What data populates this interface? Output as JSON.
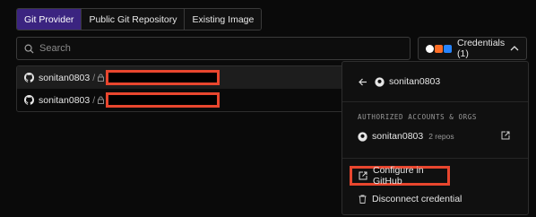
{
  "tabs": [
    {
      "label": "Git Provider",
      "active": true
    },
    {
      "label": "Public Git Repository",
      "active": false
    },
    {
      "label": "Existing Image",
      "active": false
    }
  ],
  "search": {
    "placeholder": "Search",
    "value": ""
  },
  "credentials": {
    "label": "Credentials (1)",
    "provider_icons": [
      {
        "name": "github-icon",
        "color": "#ffffff"
      },
      {
        "name": "gitlab-icon",
        "color": "#fc6d26"
      },
      {
        "name": "bitbucket-icon",
        "color": "#2684ff"
      }
    ]
  },
  "repos": [
    {
      "owner": "sonitan0803",
      "separator": "/",
      "private": true,
      "name_redacted": true
    },
    {
      "owner": "sonitan0803",
      "separator": "/",
      "private": true,
      "name_redacted": true
    }
  ],
  "panel": {
    "header_account": "sonitan0803",
    "section_label": "AUTHORIZED ACCOUNTS & ORGS",
    "account": {
      "name": "sonitan0803",
      "repos": "2 repos"
    },
    "actions": {
      "configure": "Configure in GitHub",
      "disconnect": "Disconnect credential"
    }
  },
  "colors": {
    "accent_tab": "#3b2480",
    "highlight": "#e8462e",
    "background": "#0a0a0a"
  }
}
